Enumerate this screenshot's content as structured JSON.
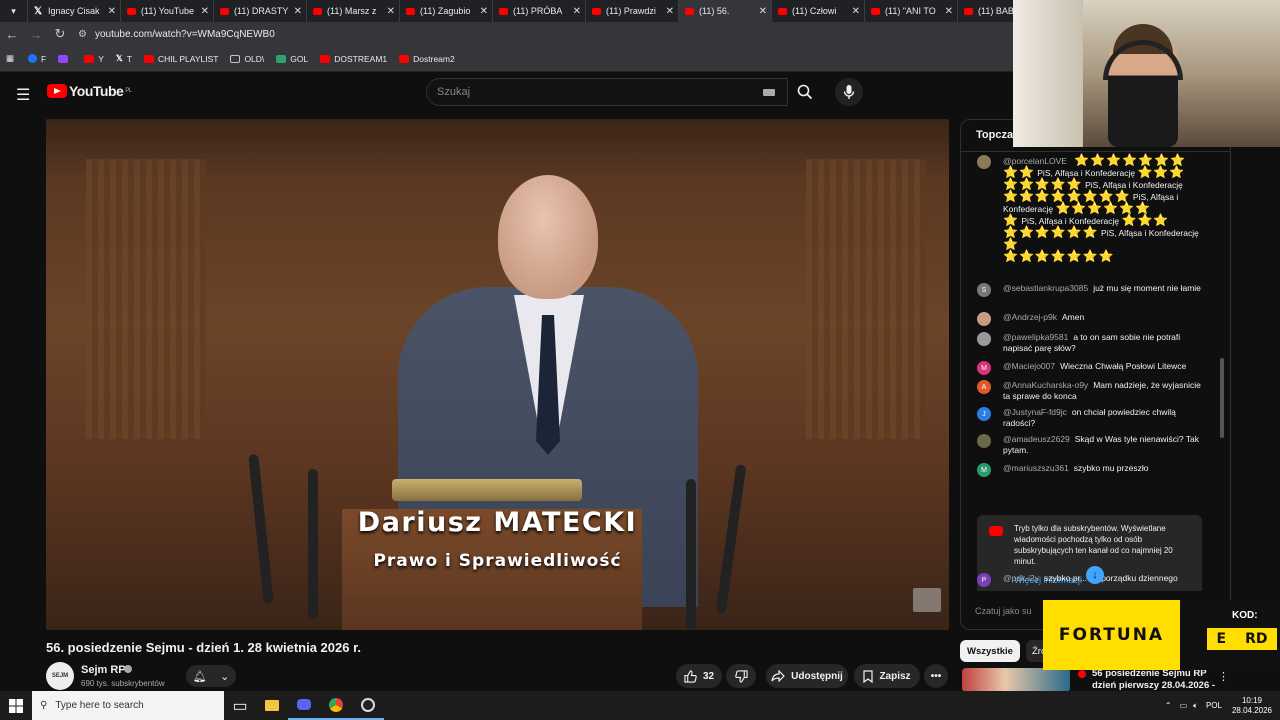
{
  "browser": {
    "tabs": [
      {
        "label": "Ignacy Cisak",
        "icon": "x-icon"
      },
      {
        "label": "(11) YouTube",
        "icon": "youtube-icon"
      },
      {
        "label": "(11) DRASTY",
        "icon": "youtube-icon"
      },
      {
        "label": "(11) Marsz z",
        "icon": "youtube-icon"
      },
      {
        "label": "(11) Zagubio",
        "icon": "youtube-icon"
      },
      {
        "label": "(11) PRÓBA",
        "icon": "youtube-icon"
      },
      {
        "label": "(11) Prawdzi",
        "icon": "youtube-icon"
      },
      {
        "label": "(11) 56.",
        "icon": "youtube-icon",
        "active": true
      },
      {
        "label": "(11) Człowi",
        "icon": "youtube-icon"
      },
      {
        "label": "(11) \"ANI TO",
        "icon": "youtube-icon"
      },
      {
        "label": "(11) BABY",
        "icon": "youtube-icon"
      }
    ],
    "url": "youtube.com/watch?v=WMa9CqNEWB0",
    "bookmarks": [
      {
        "label": "F",
        "icon": "facebook-icon",
        "color": "#1877f2"
      },
      {
        "label": "",
        "icon": "twitch-icon",
        "color": "#9146ff"
      },
      {
        "label": "Y",
        "icon": "youtube-icon",
        "color": "#ff0000"
      },
      {
        "label": "T",
        "icon": "x-icon",
        "color": "#ffffff"
      },
      {
        "label": "CHIL PLAYLIST",
        "icon": "youtube-icon",
        "color": "#ff0000"
      },
      {
        "label": "OLD\\",
        "icon": "folder-icon",
        "color": "#c4c7c5"
      },
      {
        "label": "GOL",
        "icon": "gol-icon",
        "color": "#2fa36b"
      },
      {
        "label": "DOSTREAM1",
        "icon": "youtube-icon",
        "color": "#ff0000"
      },
      {
        "label": "Dostream2",
        "icon": "youtube-icon",
        "color": "#ff0000"
      }
    ]
  },
  "youtube": {
    "logo_text": "YouTube",
    "logo_country": "PL",
    "search_placeholder": "Szukaj"
  },
  "video": {
    "caption_name": "Dariusz MATECKI",
    "caption_party": "Prawo i Sprawiedliwość",
    "title": "56. posiedzenie Sejmu - dzień 1. 28 kwietnia 2026 r.",
    "channel_name": "Sejm RP",
    "channel_avatar_text": "SEJM",
    "subscribers": "690 tys. subskrybentów",
    "likes": "32",
    "share_label": "Udostępnij",
    "save_label": "Zapisz"
  },
  "chat": {
    "header": "Topczat",
    "messages": [
      {
        "author": "@porcelanLOVE",
        "text": "",
        "avatar_color": "#8a7a5a",
        "avatar_letter": ""
      },
      {
        "author": "@sebastiankrupa3085",
        "text": "już mu się moment nie łamie",
        "avatar_color": "#777777",
        "avatar_letter": "S"
      },
      {
        "author": "@Andrzej-p9k",
        "text": "Amen",
        "avatar_color": "#c89a82",
        "avatar_letter": ""
      },
      {
        "author": "@pawelipka9581",
        "text": "a to on sam sobie nie potrafi napisać parę słów?",
        "avatar_color": "#999999",
        "avatar_letter": ""
      },
      {
        "author": "@Maciejo007",
        "text": "Wieczna Chwałą Posłowi Litewce",
        "avatar_color": "#d6337a",
        "avatar_letter": "M"
      },
      {
        "author": "@AnnaKucharska-o9y",
        "text": "Mam nadzieje, że wyjasnicie ta sprawe do konca",
        "avatar_color": "#e05a2b",
        "avatar_letter": "A"
      },
      {
        "author": "@JustynaF-fd9jc",
        "text": "on chciał powiedziec chwilą radości?",
        "avatar_color": "#2b7de0",
        "avatar_letter": "J"
      },
      {
        "author": "@amadeusz2629",
        "text": "Skąd w Was tyle nienawiści? Tak pytam.",
        "avatar_color": "#6a6a4a",
        "avatar_letter": ""
      },
      {
        "author": "@mariuszszu361",
        "text": "szybko mu przeszło",
        "avatar_color": "#2b9a6a",
        "avatar_letter": "M"
      },
      {
        "author": "@pdk-i2y",
        "text": "szybko pr... do porządku dziennego",
        "avatar_color": "#7b3fb8",
        "avatar_letter": "P"
      }
    ],
    "star_lines": [
      "PiS, Alfąsa i Konfederację",
      "PiS, Alfąsa i Konfederację",
      "PiS, Alfąsa i Konfederację",
      "PiS, Alfąsa i Konfederację",
      "PiS, Alfąsa i Konfederację"
    ],
    "sub_notice_text": "Tryb tylko dla subskrybentów. Wyświetlane wiadomości pochodzą tylko od osób subskrybujących ten kanał od co najmniej 20 minut.",
    "sub_notice_link": "Więcej informacji",
    "input_placeholder": "Czatuj jako su"
  },
  "chips": {
    "all": "Wszystkie",
    "more": "Źró"
  },
  "related": {
    "title_line1": "56 posiedzenie Sejmu RP",
    "title_line2": "dzień pierwszy 28.04.2026 -"
  },
  "promo": {
    "brand": "FORTUNA",
    "kod_label": "KOD:",
    "code_left": "E",
    "code_right": "RD"
  },
  "taskbar": {
    "search_placeholder": "Type here to search",
    "lang": "POL",
    "time": "10:19",
    "date": "28.04.2026"
  },
  "colors": {
    "accent": "#ff0000",
    "link": "#3ea6ff",
    "star": "#fcd22b",
    "fortuna": "#ffde00"
  }
}
